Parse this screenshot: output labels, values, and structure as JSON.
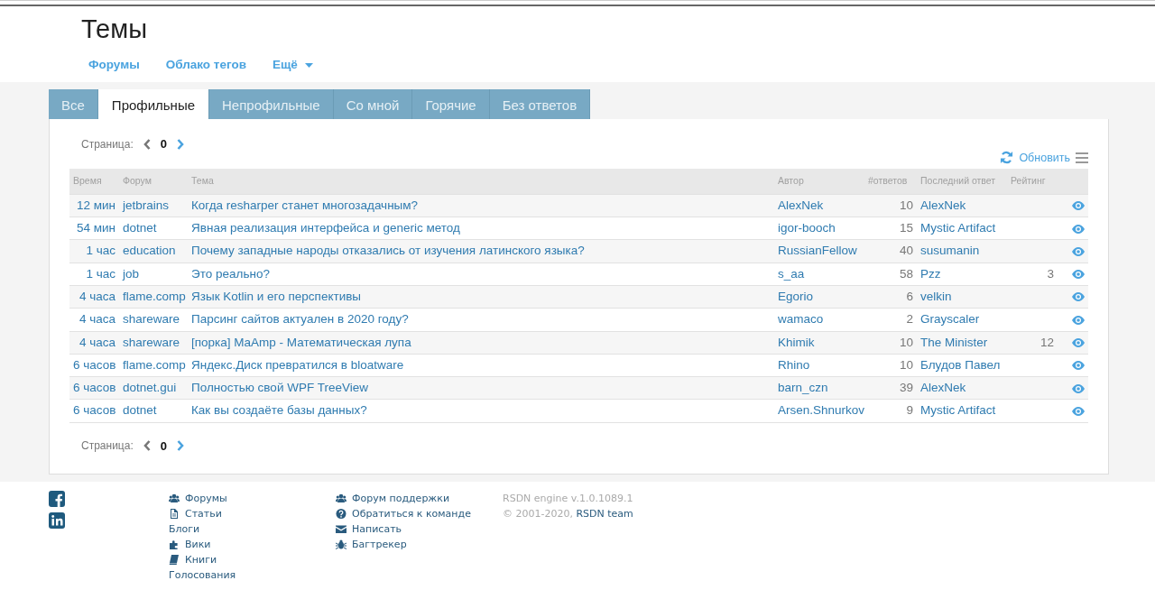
{
  "page_title": "Темы",
  "nav": [
    {
      "label": "Форумы",
      "dropdown": false
    },
    {
      "label": "Облако тегов",
      "dropdown": false
    },
    {
      "label": "Ещё",
      "dropdown": true
    }
  ],
  "tabs": [
    {
      "label": "Все",
      "selected": false
    },
    {
      "label": "Профильные",
      "selected": true
    },
    {
      "label": "Непрофильные",
      "selected": false
    },
    {
      "label": "Со мной",
      "selected": false
    },
    {
      "label": "Горячие",
      "selected": false
    },
    {
      "label": "Без ответов",
      "selected": false
    }
  ],
  "pager_top": {
    "label": "Страница:",
    "page": "0",
    "prev_disabled": true,
    "next_disabled": false
  },
  "refresh_label": "Обновить",
  "table": {
    "columns": [
      "Время",
      "Форум",
      "Тема",
      "Автор",
      "#ответов",
      "Последний ответ",
      "Рейтинг"
    ],
    "rows": [
      {
        "time": "12 мин",
        "forum": "jetbrains",
        "topic": "Когда resharper станет многозадачным?",
        "author": "AlexNek",
        "replies": "10",
        "last": "AlexNek"
      },
      {
        "time": "54 мин",
        "forum": "dotnet",
        "topic": "Явная реализация интерфейса и generic метод",
        "author": "igor-booch",
        "replies": "15",
        "last": "Mystic Artifact"
      },
      {
        "time": "1 час",
        "forum": "education",
        "topic": "Почему западные народы отказались от изучения латинского языка?",
        "author": "RussianFellow",
        "replies": "40",
        "last": "susumanin"
      },
      {
        "time": "1 час",
        "forum": "job",
        "topic": "Это реально?",
        "author": "s_aa",
        "replies": "58",
        "last": "Pzz",
        "rating": "3"
      },
      {
        "time": "4 часа",
        "forum": "flame.comp",
        "topic": "Язык Kotlin и его перспективы",
        "author": "Egorio",
        "replies": "6",
        "last": "velkin"
      },
      {
        "time": "4 часа",
        "forum": "shareware",
        "topic": "Парсинг сайтов актуален в 2020 году?",
        "author": "wamaco",
        "replies": "2",
        "last": "Grayscaler"
      },
      {
        "time": "4 часа",
        "forum": "shareware",
        "topic": "[порка] MaAmp - Математическая лупа",
        "author": "Khimik",
        "replies": "10",
        "last": "The Minister",
        "rating": "12"
      },
      {
        "time": "6 часов",
        "forum": "flame.comp",
        "topic": "Яндекс.Диск превратился в bloatware",
        "author": "Rhino",
        "replies": "10",
        "last": "Блудов Павел"
      },
      {
        "time": "6 часов",
        "forum": "dotnet.gui",
        "topic": "Полностью свой WPF TreeView",
        "author": "barn_czn",
        "replies": "39",
        "last": "AlexNek"
      },
      {
        "time": "6 часов",
        "forum": "dotnet",
        "topic": "Как вы создаёте базы данных?",
        "author": "Arsen.Shnurkov",
        "replies": "9",
        "last": "Mystic Artifact"
      }
    ]
  },
  "pager_bottom": {
    "label": "Страница:",
    "page": "0",
    "prev_disabled": true,
    "next_disabled": false
  },
  "footer": {
    "social": [
      {
        "kind": "facebook"
      },
      {
        "kind": "linkedin"
      }
    ],
    "links_1": [
      {
        "label": "Форумы",
        "kind": "users"
      },
      {
        "label": "Статьи",
        "kind": "file"
      },
      {
        "label": "Блоги",
        "kind": "none"
      },
      {
        "label": "Вики",
        "kind": "puzzle"
      },
      {
        "label": "Книги",
        "kind": "book"
      },
      {
        "label": "Голосования",
        "kind": "none"
      }
    ],
    "links_2": [
      {
        "label": "Форум поддержки",
        "kind": "users"
      },
      {
        "label": "Обратиться к команде",
        "kind": "question"
      },
      {
        "label": "Написать",
        "kind": "envelope"
      },
      {
        "label": "Багтрекер",
        "kind": "bug"
      }
    ],
    "version": "RSDN engine v.1.0.1089.1",
    "copyright": "© 2001-2020,",
    "team_link": "RSDN team"
  }
}
